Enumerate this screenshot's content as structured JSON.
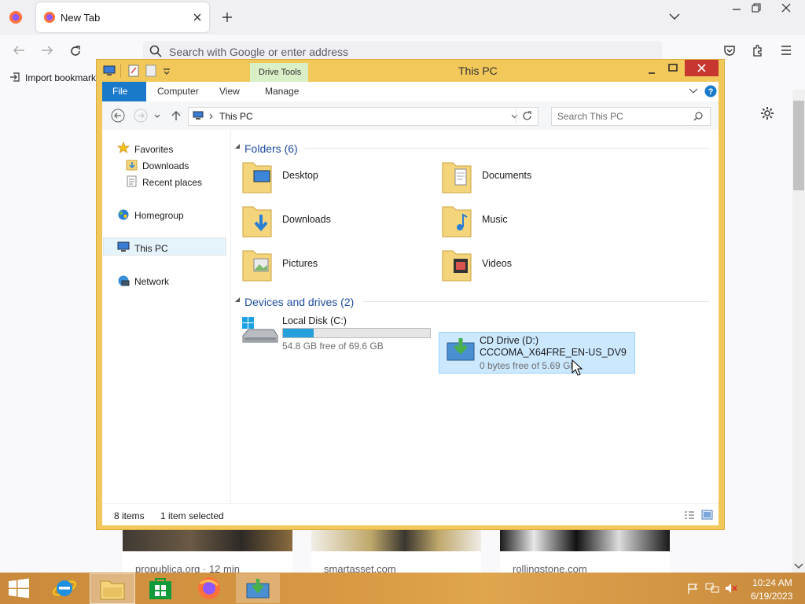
{
  "browser": {
    "tab_title": "New Tab",
    "url_placeholder": "Search with Google or enter address",
    "import_bookmarks": "Import bookmark",
    "cards": [
      {
        "domain": "propublica.org · 12 min"
      },
      {
        "domain": "smartasset.com"
      },
      {
        "domain": "rollingstone.com"
      }
    ]
  },
  "explorer": {
    "title": "This PC",
    "contextual_tab": "Drive Tools",
    "ribbon_tabs": [
      "File",
      "Computer",
      "View",
      "Manage"
    ],
    "address": "This PC",
    "search_placeholder": "Search This PC",
    "nav": {
      "favorites": "Favorites",
      "downloads": "Downloads",
      "recent": "Recent places",
      "homegroup": "Homegroup",
      "thispc": "This PC",
      "network": "Network"
    },
    "folders_header": "Folders (6)",
    "folders": [
      {
        "name": "Desktop",
        "icon": "desktop-folder-icon"
      },
      {
        "name": "Documents",
        "icon": "documents-folder-icon"
      },
      {
        "name": "Downloads",
        "icon": "downloads-folder-icon"
      },
      {
        "name": "Music",
        "icon": "music-folder-icon"
      },
      {
        "name": "Pictures",
        "icon": "pictures-folder-icon"
      },
      {
        "name": "Videos",
        "icon": "videos-folder-icon"
      }
    ],
    "drives_header": "Devices and drives (2)",
    "drives": [
      {
        "name": "Local Disk (C:)",
        "label": "",
        "free": "54.8 GB free of 69.6 GB",
        "used_fraction": 0.21
      },
      {
        "name": "CD Drive (D:)",
        "label": "CCCOMA_X64FRE_EN-US_DV9",
        "free": "0 bytes free of 5.69 GB"
      }
    ],
    "status": {
      "items": "8 items",
      "selected": "1 item selected"
    }
  },
  "taskbar": {
    "time": "10:24 AM",
    "date": "6/19/2023"
  },
  "colors": {
    "window_frame": "#f2c85a",
    "taskbar": "#d89a45",
    "accent_blue": "#1979ca",
    "selection": "#cce8ff",
    "close_red": "#c7372f"
  }
}
